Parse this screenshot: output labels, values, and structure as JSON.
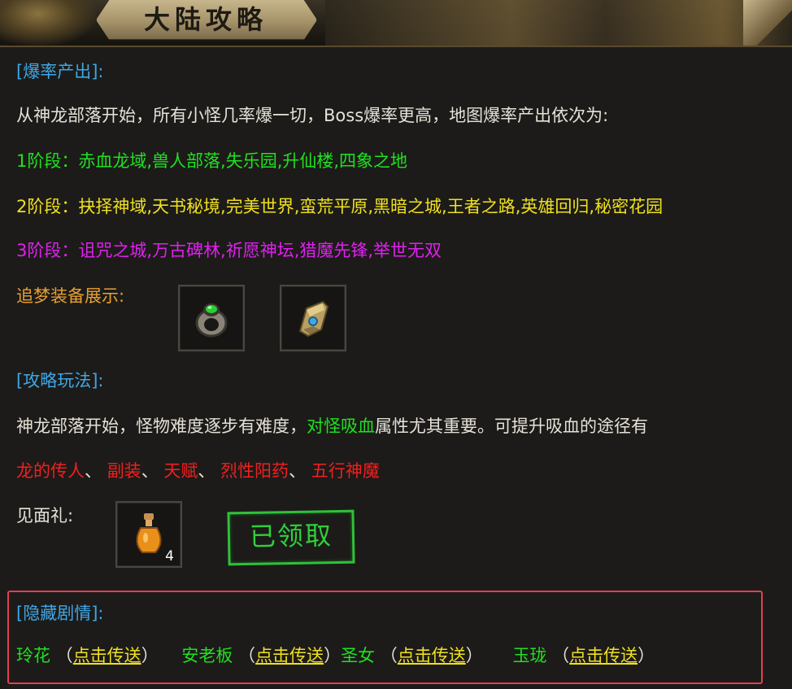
{
  "header": {
    "title": "大陆攻略"
  },
  "drops": {
    "heading": "[爆率产出]:",
    "intro": "从神龙部落开始，所有小怪几率爆一切，Boss爆率更高，地图爆率产出依次为:",
    "stage1": "1阶段：赤血龙域,兽人部落,失乐园,升仙楼,四象之地",
    "stage2": "2阶段：抉择神域,天书秘境,完美世界,蛮荒平原,黑暗之城,王者之路,英雄回归,秘密花园",
    "stage3": "3阶段：诅咒之城,万古碑林,祈愿神坛,猎魔先锋,举世无双",
    "gear_label": "追梦装备展示:",
    "gear_items": [
      "ring-icon",
      "bracer-icon"
    ]
  },
  "strategy": {
    "heading": "[攻略玩法]:",
    "text_before": "神龙部落开始，怪物难度逐步有难度，",
    "highlight": "对怪吸血",
    "text_after": "属性尤其重要。可提升吸血的途径有",
    "sources": [
      "龙的传人",
      "副装",
      "天赋",
      "烈性阳药",
      "五行神魔"
    ],
    "separator": "、",
    "gift_label": "见面礼:",
    "gift_item": "potion-icon",
    "gift_count": "4",
    "claimed_stamp": "已领取"
  },
  "hidden_story": {
    "heading": "[隐藏剧情]:",
    "npcs": [
      {
        "name": "玲花",
        "link": "点击传送"
      },
      {
        "name": "安老板",
        "link": "点击传送"
      },
      {
        "name": "圣女",
        "link": "点击传送"
      },
      {
        "name": "玉珑",
        "link": "点击传送"
      }
    ]
  },
  "colors": {
    "heading_blue": "#3fa7e6",
    "stage1_green": "#20e020",
    "stage2_yellow": "#f0e020",
    "stage3_magenta": "#e020f0",
    "highlight_red": "#f02020",
    "frame_red": "#e04050"
  }
}
